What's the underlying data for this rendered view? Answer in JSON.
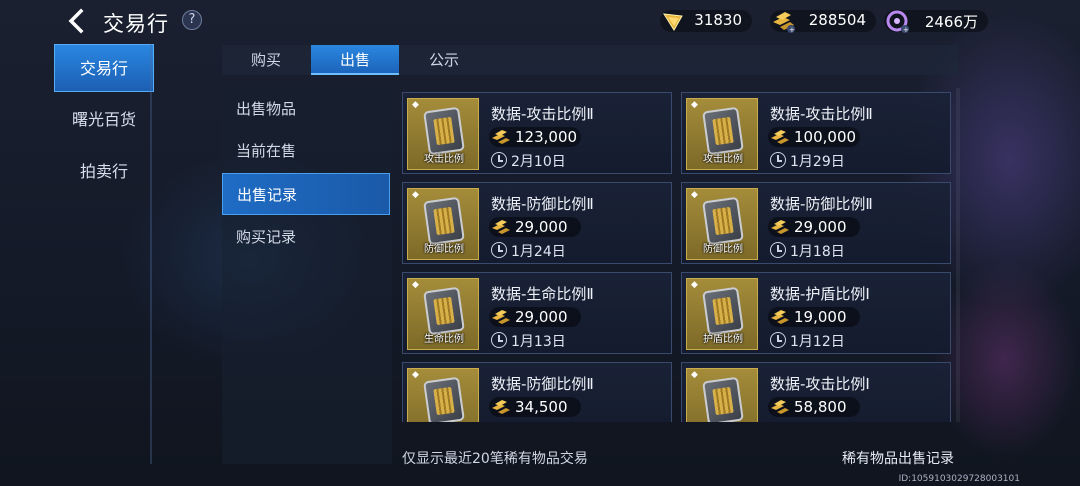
{
  "header": {
    "back_icon": "chevron-left-icon",
    "title": "交易行",
    "help": "?",
    "currencies": [
      {
        "icon": "gold-wings-icon",
        "value": "31830"
      },
      {
        "icon": "gold-bars-icon",
        "value": "288504"
      },
      {
        "icon": "purple-orb-icon",
        "value": "2466万"
      }
    ]
  },
  "nav": {
    "items": [
      {
        "label": "交易行",
        "active": true
      },
      {
        "label": "曙光百货",
        "active": false
      },
      {
        "label": "拍卖行",
        "active": false
      }
    ]
  },
  "tabs": [
    {
      "label": "购买",
      "active": false
    },
    {
      "label": "出售",
      "active": true
    },
    {
      "label": "公示",
      "active": false
    }
  ],
  "subnav": [
    {
      "label": "出售物品",
      "active": false
    },
    {
      "label": "当前在售",
      "active": false
    },
    {
      "label": "出售记录",
      "active": true
    },
    {
      "label": "购买记录",
      "active": false
    }
  ],
  "items": [
    {
      "name": "数据-攻击比例Ⅱ",
      "thumb_label": "攻击比例",
      "price": "123,000",
      "date": "2月10日"
    },
    {
      "name": "数据-攻击比例Ⅱ",
      "thumb_label": "攻击比例",
      "price": "100,000",
      "date": "1月29日"
    },
    {
      "name": "数据-防御比例Ⅱ",
      "thumb_label": "防御比例",
      "price": "29,000",
      "date": "1月24日"
    },
    {
      "name": "数据-防御比例Ⅱ",
      "thumb_label": "防御比例",
      "price": "29,000",
      "date": "1月18日"
    },
    {
      "name": "数据-生命比例Ⅱ",
      "thumb_label": "生命比例",
      "price": "29,000",
      "date": "1月13日"
    },
    {
      "name": "数据-护盾比例Ⅰ",
      "thumb_label": "护盾比例",
      "price": "19,000",
      "date": "1月12日"
    },
    {
      "name": "数据-防御比例Ⅱ",
      "thumb_label": "防御比例",
      "price": "34,500",
      "date": "1月11日"
    },
    {
      "name": "数据-攻击比例Ⅰ",
      "thumb_label": "攻击比例",
      "price": "58,800",
      "date": "1月10日"
    }
  ],
  "footer": {
    "notice": "仅显示最近20笔稀有物品交易",
    "rare_link": "稀有物品出售记录",
    "uid": "ID:1059103029728003101"
  }
}
